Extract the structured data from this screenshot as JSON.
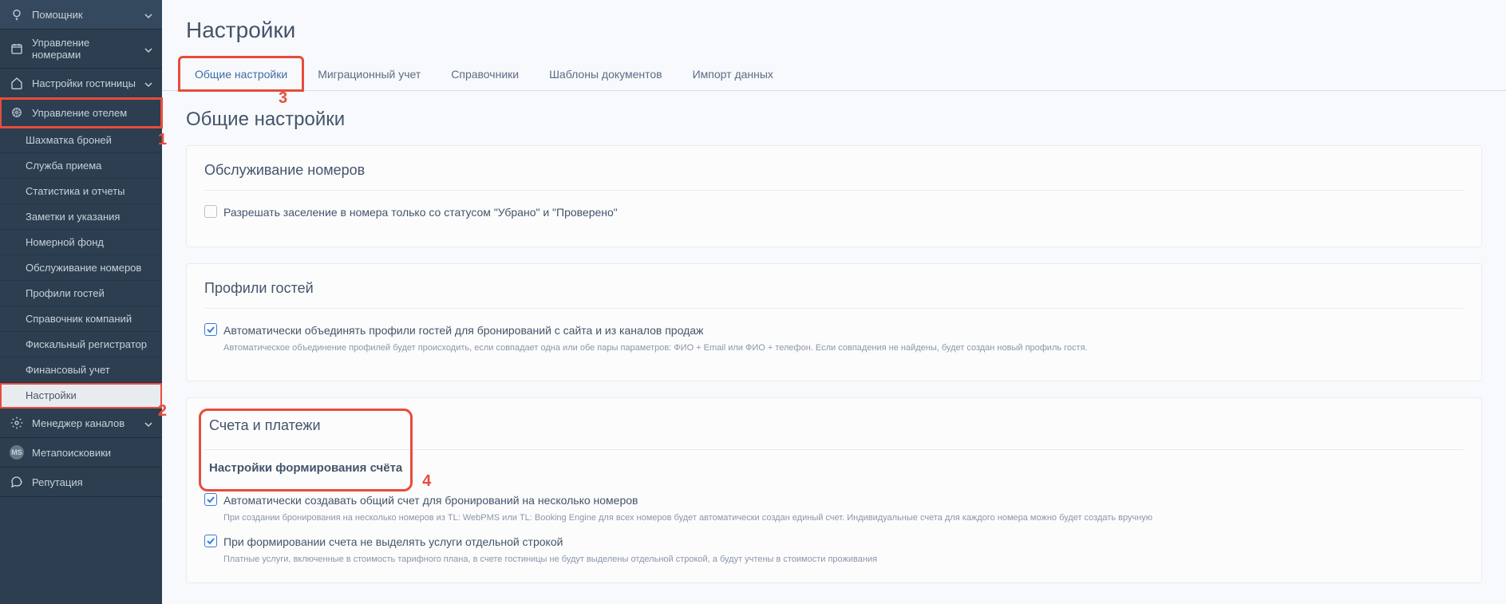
{
  "sidebar": {
    "sections": [
      {
        "label": "Помощник",
        "icon": "lightbulb",
        "dropdown": true
      },
      {
        "label": "Управление номерами",
        "icon": "calendar",
        "dropdown": true
      },
      {
        "label": "Настройки гостиницы",
        "icon": "home",
        "dropdown": true
      },
      {
        "label": "Управление отелем",
        "icon": "wheel",
        "dropdown": false
      },
      {
        "label": "Менеджер каналов",
        "icon": "gear",
        "dropdown": true
      },
      {
        "label": "Метапоисковики",
        "icon": "ms",
        "dropdown": false
      },
      {
        "label": "Репутация",
        "icon": "chat",
        "dropdown": false
      }
    ],
    "subitems": [
      "Шахматка броней",
      "Служба приема",
      "Статистика и отчеты",
      "Заметки и указания",
      "Номерной фонд",
      "Обслуживание номеров",
      "Профили гостей",
      "Справочник компаний",
      "Фискальный регистратор",
      "Финансовый учет",
      "Настройки"
    ]
  },
  "page_title": "Настройки",
  "tabs": [
    "Общие настройки",
    "Миграционный учет",
    "Справочники",
    "Шаблоны документов",
    "Импорт данных"
  ],
  "section_title": "Общие настройки",
  "cards": {
    "room_service": {
      "title": "Обслуживание номеров",
      "check1_label": "Разрешать заселение в номера только со статусом \"Убрано\" и \"Проверено\""
    },
    "guest_profiles": {
      "title": "Профили гостей",
      "check1_label": "Автоматически объединять профили гостей для бронирований с сайта и из каналов продаж",
      "check1_hint": "Автоматическое объединение профилей будет происходить, если совпадает одна или обе пары параметров: ФИО + Email или ФИО + телефон. Если совпадения не найдены, будет создан новый профиль гостя."
    },
    "invoices": {
      "title": "Счета и платежи",
      "subtitle": "Настройки формирования счёта",
      "check1_label": "Автоматически создавать общий счет для бронирований на несколько номеров",
      "check1_hint": "При создании бронирования на несколько номеров из TL: WebPMS или TL: Booking Engine для всех номеров будет автоматически создан единый счет. Индивидуальные счета для каждого номера можно будет создать вручную",
      "check2_label": "При формировании счета не выделять услуги отдельной строкой",
      "check2_hint": "Платные услуги, включенные в стоимость тарифного плана, в счете гостиницы не будут выделены отдельной строкой, а будут учтены в стоимости проживания"
    }
  },
  "annotations": {
    "n1": "1",
    "n2": "2",
    "n3": "3",
    "n4": "4"
  },
  "ms_label": "MS"
}
